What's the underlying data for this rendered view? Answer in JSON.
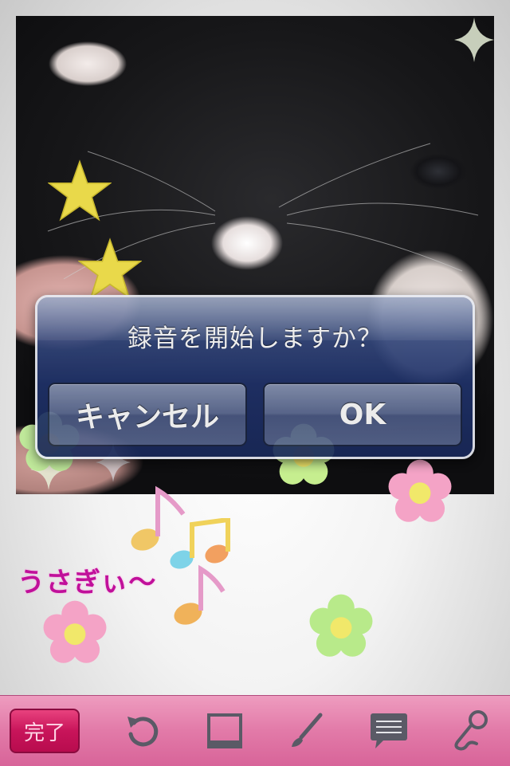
{
  "dialog": {
    "title": "録音を開始しますか？",
    "cancel_label": "キャンセル",
    "ok_label": "OK"
  },
  "caption": "うさぎぃ〜",
  "toolbar": {
    "done_label": "完了",
    "tools": [
      "undo-icon",
      "frame-icon",
      "brush-icon",
      "speech-bubble-icon",
      "microphone-icon"
    ]
  },
  "colors": {
    "toolbar": "#e27aa8",
    "done_button": "#c8145a",
    "caption": "#c0109a",
    "dialog": "#1f3168"
  }
}
